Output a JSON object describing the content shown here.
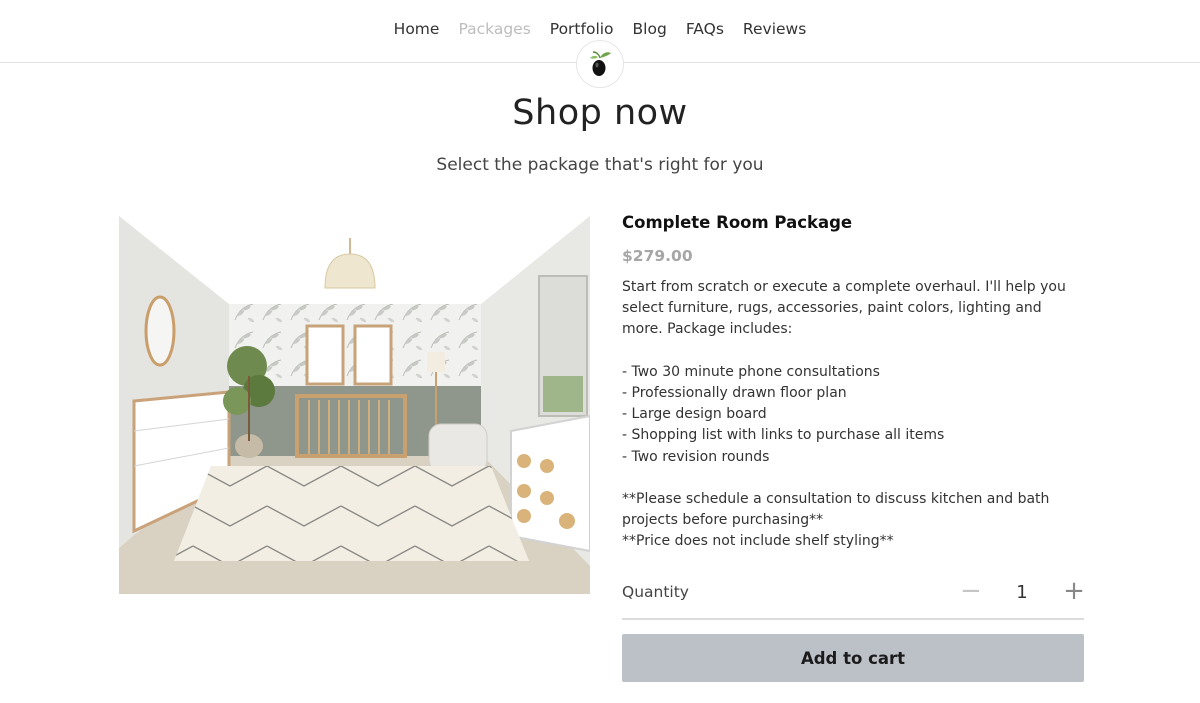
{
  "nav": {
    "items": [
      {
        "label": "Home",
        "active": false
      },
      {
        "label": "Packages",
        "active": true
      },
      {
        "label": "Portfolio",
        "active": false
      },
      {
        "label": "Blog",
        "active": false
      },
      {
        "label": "FAQs",
        "active": false
      },
      {
        "label": "Reviews",
        "active": false
      }
    ],
    "logo_icon": "olive-logo-icon"
  },
  "page": {
    "title": "Shop now",
    "subtitle": "Select the package that's right for you"
  },
  "product": {
    "image_icon": "nursery-room-rendering",
    "name": "Complete Room Package",
    "price": "$279.00",
    "description": {
      "intro": "Start from scratch or execute a complete overhaul. I'll help you select furniture, rugs, accessories, paint colors, lighting and more. Package includes:",
      "includes": [
        "- Two 30 minute phone consultations",
        "- Professionally drawn floor plan",
        "- Large design board",
        "- Shopping list with links to purchase all items",
        "- Two revision rounds"
      ],
      "note_1": "**Please schedule a consultation to discuss kitchen and bath projects before purchasing**",
      "note_2": "**Price does not include shelf styling**"
    }
  },
  "quantity": {
    "label": "Quantity",
    "minus_symbol": "−",
    "value": "1",
    "plus_symbol": "+"
  },
  "cart": {
    "button_label": "Add to cart"
  },
  "colors": {
    "active_nav": "#bdbdbd",
    "price": "#a6a6a6",
    "button_bg": "#bcc1c8"
  }
}
